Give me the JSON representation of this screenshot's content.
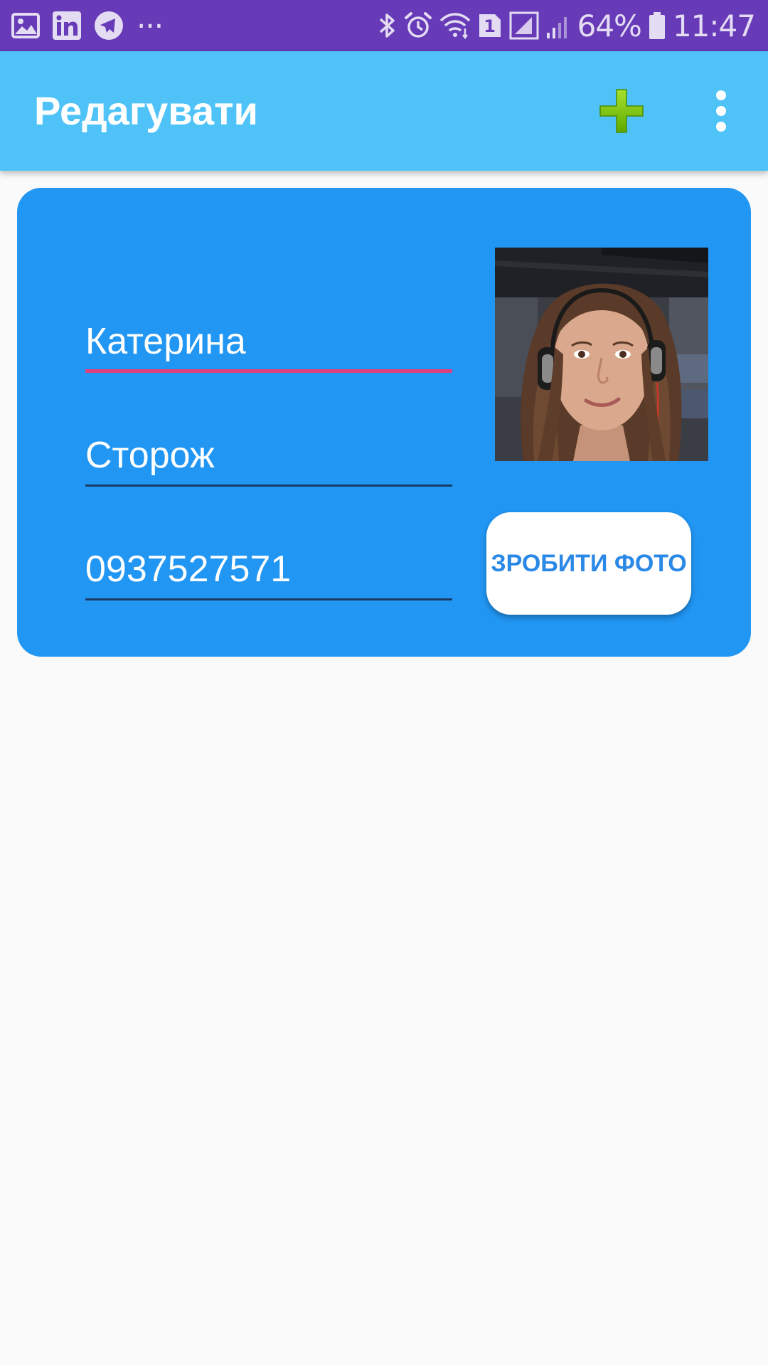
{
  "status_bar": {
    "battery_percent": "64%",
    "time": "11:47",
    "sim_slot": "1",
    "left_icons": [
      "gallery-icon",
      "linkedin-icon",
      "telegram-icon",
      "more-notifications-icon"
    ],
    "right_icons": [
      "bluetooth-icon",
      "alarm-icon",
      "wifi-icon",
      "sim-1-icon",
      "cell-signal-icon",
      "cell-signal-2-icon",
      "battery-icon"
    ],
    "more_text": "···",
    "colors": {
      "background": "#673ab7",
      "foreground": "#e4dcf3"
    }
  },
  "app_bar": {
    "title": "Редагувати",
    "actions": [
      "add-icon",
      "more-vert-icon"
    ],
    "colors": {
      "background": "#4fc3f7",
      "add_icon": "#7cc800"
    }
  },
  "card": {
    "colors": {
      "background": "#2196f3",
      "focus_underline": "#e0407d"
    },
    "first_name": "Катерина",
    "last_name": "Сторож",
    "phone": "0937527571",
    "photo_button_label": "ЗРОБИТИ ФОТО"
  },
  "page": {
    "colors": {
      "background": "#fafafa"
    }
  }
}
